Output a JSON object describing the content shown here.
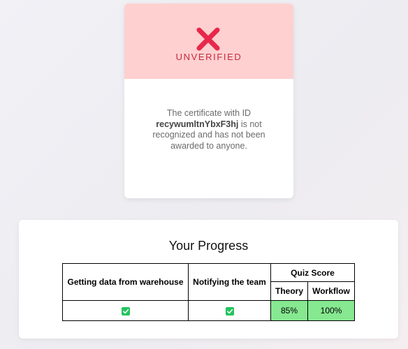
{
  "certificate": {
    "status": "UNVERIFIED",
    "status_icon": "cross-icon",
    "message_before": "The certificate with ID",
    "certificate_id": "recywumltnYbxF3hj",
    "message_after": "is not recognized and has not been awarded to anyone.",
    "colors": {
      "header_bg": "#ffd0d0",
      "icon": "#e8284b",
      "status_text": "#c6283f"
    }
  },
  "progress": {
    "title": "Your Progress",
    "columns": {
      "module1": "Getting data from warehouse",
      "module2": "Notifying the team",
      "quiz_score": "Quiz Score",
      "theory": "Theory",
      "workflow": "Workflow"
    },
    "row": {
      "module1_completed": true,
      "module2_completed": true,
      "theory_score": "85%",
      "workflow_score": "100%"
    },
    "check_icon": "checkbox-checked-icon",
    "colors": {
      "check": "#22c55e",
      "score_bg": "#86e890"
    }
  }
}
